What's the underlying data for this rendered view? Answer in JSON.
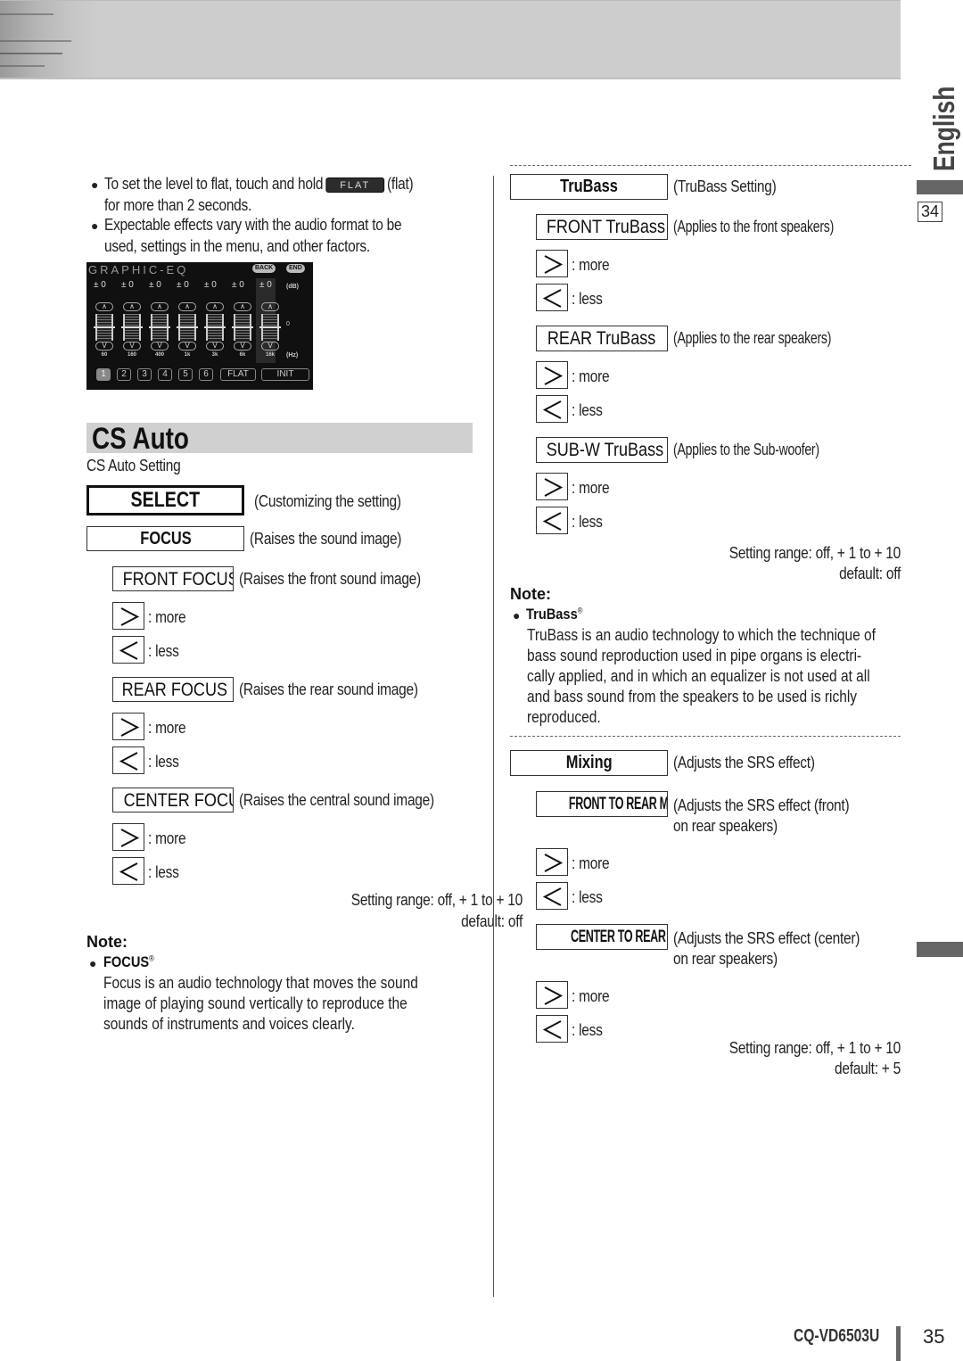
{
  "banner": {},
  "left": {
    "bullets": [
      {
        "before": "To set the level to flat, touch and hold",
        "key": "FLAT",
        "after": "(flat)",
        "line2": "for more than 2 seconds."
      },
      {
        "line1": "Expectable effects vary with the audio format to be",
        "line2": "used, settings in the menu, and other factors."
      }
    ],
    "eq_screen": {
      "title": "GRAPHIC-EQ",
      "back": "BACK",
      "end": "END",
      "db_values": [
        "± 0",
        "± 0",
        "± 0",
        "± 0",
        "± 0",
        "± 0",
        "± 0"
      ],
      "db_unit": "(dB)",
      "zero_label": "0",
      "hz_unit": "(Hz)",
      "up": "∧",
      "down": "V",
      "bands": [
        "60",
        "160",
        "400",
        "1k",
        "3k",
        "6k",
        "16k"
      ],
      "presets": [
        "1",
        "2",
        "3",
        "4",
        "5",
        "6",
        "FLAT",
        "INIT"
      ]
    },
    "section_title": "CS Auto",
    "section_subtitle": "CS Auto Setting",
    "select": {
      "label": "SELECT",
      "desc": "(Customizing the setting)"
    },
    "focus": {
      "label": "FOCUS",
      "desc": "(Raises the sound image)"
    },
    "sub_items": [
      {
        "label": "FRONT FOCUS",
        "desc": "(Raises the front sound image)",
        "more": ": more",
        "less": ": less"
      },
      {
        "label": "REAR FOCUS",
        "desc": "(Raises the rear sound image)",
        "more": ": more",
        "less": ": less"
      },
      {
        "label": "CENTER FOCUS",
        "desc": "(Raises the central sound image)",
        "more": ": more",
        "less": ": less"
      }
    ],
    "range": "Setting range: off, + 1 to + 10",
    "default": "default: off",
    "note": {
      "title": "Note:",
      "head": "FOCUS",
      "reg": "®",
      "lines": [
        "Focus is an audio technology that moves the sound",
        "image of playing sound vertically to reproduce the",
        "sounds of instruments and voices clearly."
      ]
    }
  },
  "right": {
    "trubass": {
      "label": "TruBass",
      "desc": "(TruBass Setting)"
    },
    "trubass_items": [
      {
        "label": "FRONT TruBass",
        "desc": "(Applies to the front speakers)",
        "more": ": more",
        "less": ": less"
      },
      {
        "label": "REAR TruBass",
        "desc": "(Applies to the rear speakers)",
        "more": ": more",
        "less": ": less"
      },
      {
        "label": "SUB-W TruBass",
        "desc": "(Applies to the Sub-woofer)",
        "more": ": more",
        "less": ": less"
      }
    ],
    "trubass_range": "Setting range: off, + 1 to + 10",
    "trubass_default": "default: off",
    "note": {
      "title": "Note:",
      "head": "TruBass",
      "reg": "®",
      "lines": [
        "TruBass is an audio technology to which the technique of",
        "bass sound reproduction used in pipe organs is electri-",
        "cally applied, and in which an equalizer is not used at all",
        "and bass sound from the speakers to be used is richly",
        "reproduced."
      ]
    },
    "mixing": {
      "label": "Mixing",
      "desc": "(Adjusts the SRS effect)"
    },
    "mixing_items": [
      {
        "label": "FRONT TO REAR Mixing",
        "desc1": "(Adjusts the SRS effect (front)",
        "desc2": "on rear speakers)",
        "more": ": more",
        "less": ": less"
      },
      {
        "label": "CENTER TO REAR Mixing",
        "desc1": "(Adjusts the SRS effect (center)",
        "desc2": "on rear speakers)",
        "more": ": more",
        "less": ": less"
      }
    ],
    "mixing_range": "Setting range: off, + 1 to + 10",
    "mixing_default": "default: + 5"
  },
  "side": {
    "language": "English",
    "page_ref": "34"
  },
  "footer": {
    "model": "CQ-VD6503U",
    "page": "35"
  }
}
